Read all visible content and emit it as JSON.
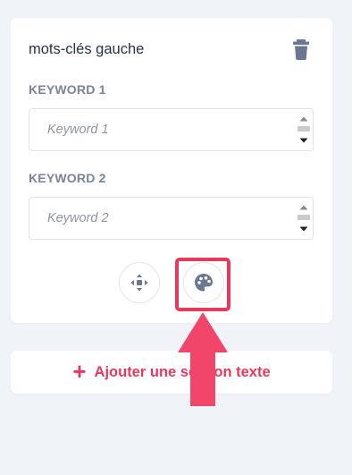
{
  "card": {
    "title": "mots-clés gauche",
    "delete_icon": "trash-icon",
    "fields": [
      {
        "label": "KEYWORD 1",
        "value": "",
        "placeholder": "Keyword 1"
      },
      {
        "label": "KEYWORD 2",
        "value": "",
        "placeholder": "Keyword 2"
      }
    ],
    "actions": {
      "move_icon": "move-arrows-icon",
      "style_icon": "palette-icon"
    }
  },
  "add_section": {
    "icon": "plus-icon",
    "label": "Ajouter une section texte"
  },
  "annotation": {
    "highlight_color": "#e8395c",
    "arrow_icon": "up-arrow-icon"
  },
  "colors": {
    "background": "#f0f3f8",
    "accent": "#e8395c",
    "label": "#7a8497",
    "icon": "#6b7790"
  }
}
